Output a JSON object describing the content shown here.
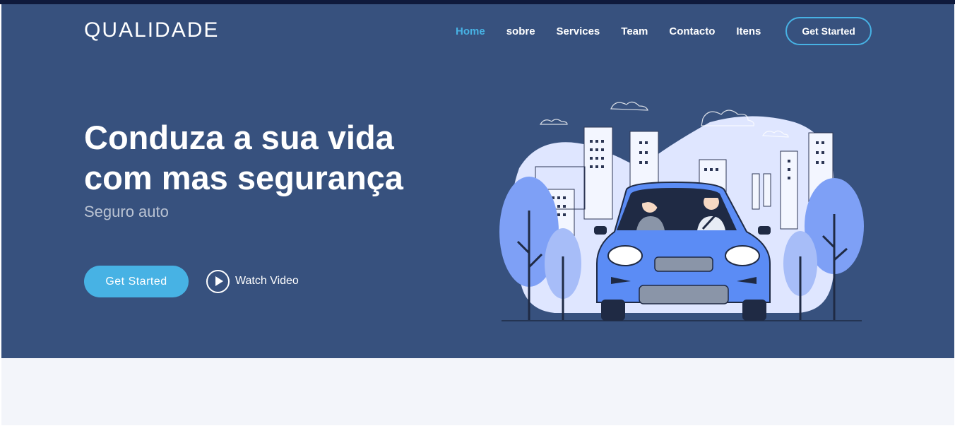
{
  "header": {
    "logo": "QUALIDADE",
    "nav": [
      {
        "label": "Home",
        "active": true
      },
      {
        "label": "sobre",
        "active": false
      },
      {
        "label": "Services",
        "active": false
      },
      {
        "label": "Team",
        "active": false
      },
      {
        "label": "Contacto",
        "active": false
      },
      {
        "label": "Itens",
        "active": false
      }
    ],
    "cta_label": "Get Started"
  },
  "hero": {
    "title": "Conduza a sua vida com mas segurança",
    "subtitle": "Seguro auto",
    "primary_button": "Get Started",
    "video_link": "Watch Video"
  },
  "colors": {
    "hero_bg": "#37517e",
    "accent": "#47b2e4",
    "top_strip": "#0f1a3c",
    "section_bg": "#f3f5fa"
  },
  "icons": {
    "play": "play-circle-icon"
  }
}
